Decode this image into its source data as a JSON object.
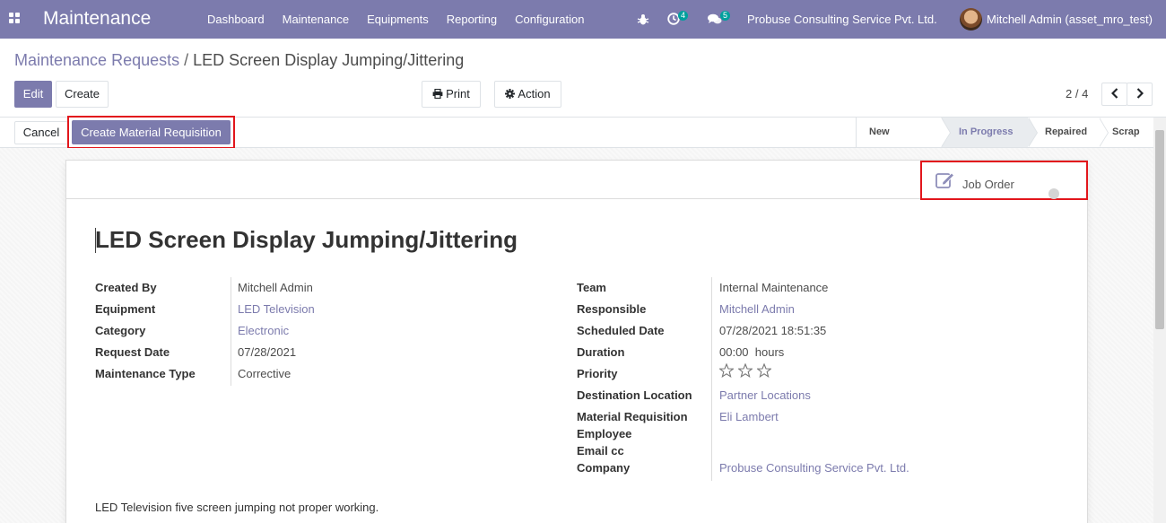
{
  "navbar": {
    "brand": "Maintenance",
    "menu": [
      "Dashboard",
      "Maintenance",
      "Equipments",
      "Reporting",
      "Configuration"
    ],
    "activity_count": "4",
    "message_count": "5",
    "company": "Probuse Consulting Service Pvt. Ltd.",
    "user": "Mitchell Admin (asset_mro_test)"
  },
  "breadcrumb": {
    "parent": "Maintenance Requests",
    "separator": "/",
    "current": "LED Screen Display Jumping/Jittering"
  },
  "toolbar": {
    "edit": "Edit",
    "create": "Create",
    "print": "Print",
    "action": "Action",
    "pager": "2 / 4"
  },
  "statusbar": {
    "cancel": "Cancel",
    "create_material_requisition": "Create Material Requisition",
    "stages": [
      {
        "label": "New Request",
        "active": false
      },
      {
        "label": "In Progress",
        "active": true
      },
      {
        "label": "Repaired",
        "active": false
      },
      {
        "label": "Scrap",
        "active": false
      }
    ]
  },
  "smart_button": {
    "label": "Job Order"
  },
  "form": {
    "title": "LED Screen Display Jumping/Jittering",
    "left": [
      {
        "label": "Created By",
        "value": "Mitchell Admin",
        "link": false
      },
      {
        "label": "Equipment",
        "value": "LED Television",
        "link": true
      },
      {
        "label": "Category",
        "value": "Electronic",
        "link": true
      },
      {
        "label": "Request Date",
        "value": "07/28/2021",
        "link": false
      },
      {
        "label": "Maintenance Type",
        "value": "Corrective",
        "link": false
      }
    ],
    "right": [
      {
        "label": "Team",
        "value": "Internal Maintenance",
        "link": false
      },
      {
        "label": "Responsible",
        "value": "Mitchell Admin",
        "link": true
      },
      {
        "label": "Scheduled Date",
        "value": "07/28/2021 18:51:35",
        "link": false
      },
      {
        "label": "Duration",
        "value": "00:00  hours",
        "link": false
      },
      {
        "label": "Priority",
        "value": "",
        "link": false
      },
      {
        "label": "Destination Location",
        "value": "Partner Locations",
        "link": true
      },
      {
        "label": "Material Requisition",
        "value": "Eli Lambert",
        "link": true
      },
      {
        "label": "Employee",
        "value": "",
        "link": false
      },
      {
        "label": "Email cc",
        "value": "",
        "link": false
      },
      {
        "label": "Company",
        "value": "Probuse Consulting Service Pvt. Ltd.",
        "link": true
      }
    ],
    "priority_stars": 0,
    "description": "LED Television five screen jumping not proper working."
  },
  "colors": {
    "brand": "#7c7bad",
    "badge": "#00a09d",
    "highlight_box": "#e2161c"
  }
}
